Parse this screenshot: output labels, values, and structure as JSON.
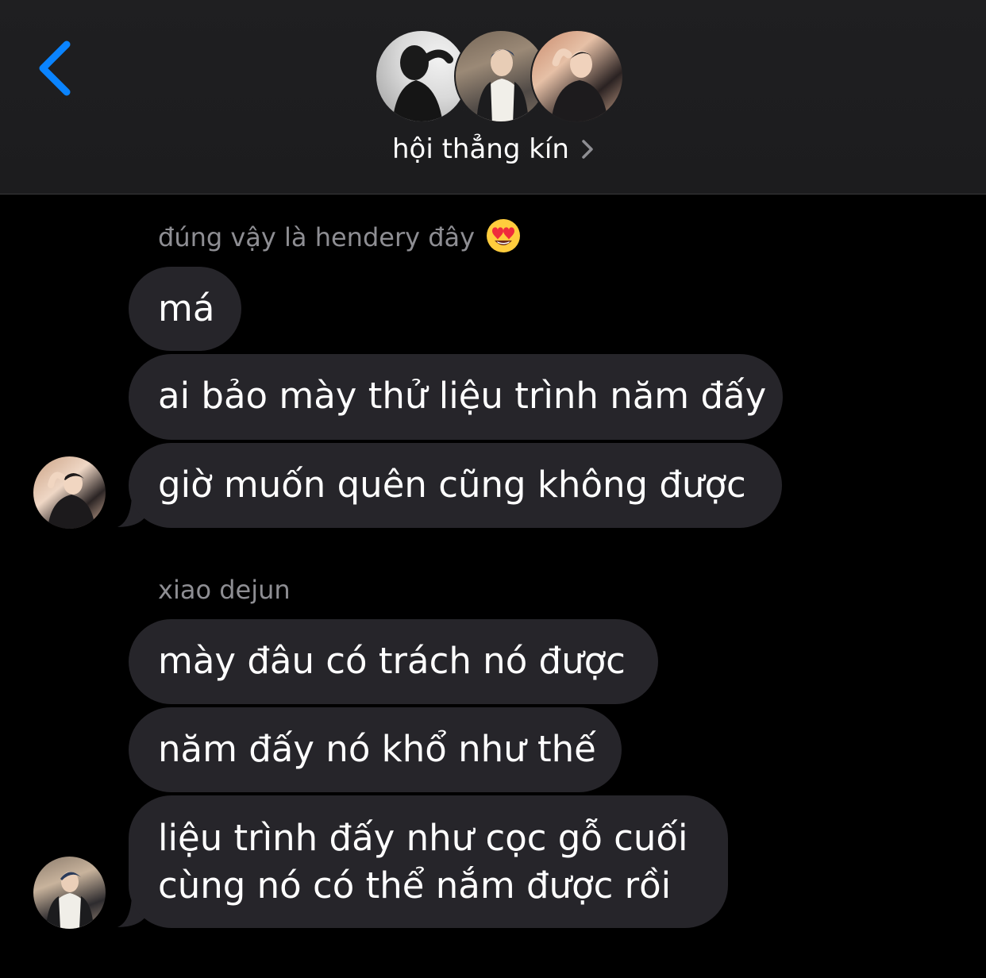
{
  "header": {
    "back_icon": "chevron-left-icon",
    "group_title": "hội thẳng kín",
    "title_chevron_icon": "chevron-right-icon",
    "avatars": [
      "group-avatar-1",
      "group-avatar-2",
      "group-avatar-3"
    ],
    "accent_color": "#0a84ff"
  },
  "messages": {
    "group1": {
      "sender": "đúng vậy là hendery đây",
      "sender_emoji": "heart-eyes-emoji",
      "bubbles": [
        "má",
        "ai bảo mày thử liệu trình năm đấy",
        "giờ muốn quên cũng không được"
      ]
    },
    "group2": {
      "sender": "xiao dejun",
      "bubbles": [
        "mày đâu có trách nó được",
        "năm đấy nó khổ như thế",
        "liệu trình đấy như cọc gỗ cuối cùng nó có thể nắm được rồi"
      ]
    }
  },
  "colors": {
    "background": "#000000",
    "header_bg": "#1c1c1e",
    "bubble_bg": "#26252a",
    "sender_text": "#8e8e93",
    "text": "#ffffff"
  }
}
